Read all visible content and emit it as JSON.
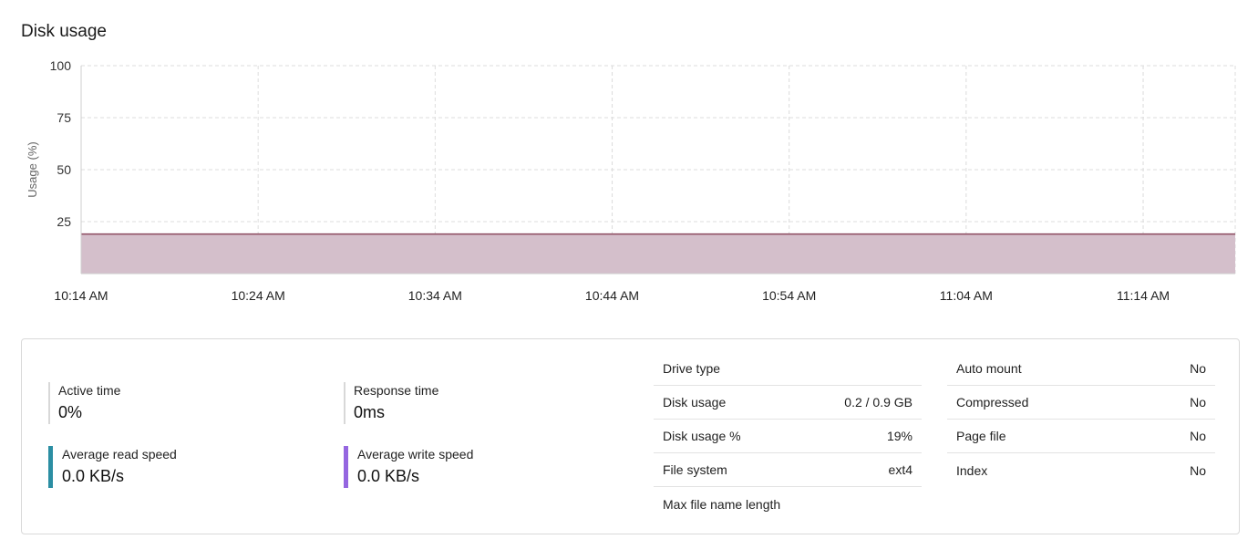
{
  "page": {
    "title": "Disk usage"
  },
  "chart_data": {
    "type": "area",
    "ylabel": "Usage (%)",
    "xlabel": "",
    "ylim": [
      0,
      100
    ],
    "yticks": [
      25,
      50,
      75,
      100
    ],
    "x_ticks": [
      "10:14 AM",
      "10:24 AM",
      "10:34 AM",
      "10:44 AM",
      "10:54 AM",
      "11:04 AM",
      "11:14 AM"
    ],
    "series": [
      {
        "values": [
          19,
          19,
          19,
          19,
          19,
          19,
          19,
          19
        ]
      }
    ],
    "x_minutes": [
      0,
      10,
      20,
      30,
      40,
      50,
      60,
      65.2
    ],
    "grid": true,
    "colors": {
      "line": "#8c4a5f",
      "fill": "#d4bfcb"
    }
  },
  "metrics": {
    "active_time": {
      "label": "Active time",
      "value": "0%"
    },
    "response_time": {
      "label": "Response time",
      "value": "0ms"
    },
    "read_speed": {
      "label": "Average read speed",
      "value": "0.0 KB/s",
      "color": "#2b8ea3"
    },
    "write_speed": {
      "label": "Average write speed",
      "value": "0.0 KB/s",
      "color": "#9566e0"
    }
  },
  "drive_info": [
    {
      "label": "Drive type",
      "value": ""
    },
    {
      "label": "Disk usage",
      "value": "0.2 / 0.9 GB"
    },
    {
      "label": "Disk usage %",
      "value": "19%"
    },
    {
      "label": "File system",
      "value": "ext4"
    },
    {
      "label": "Max file name length",
      "value": ""
    }
  ],
  "flags": [
    {
      "label": "Auto mount",
      "value": "No"
    },
    {
      "label": "Compressed",
      "value": "No"
    },
    {
      "label": "Page file",
      "value": "No"
    },
    {
      "label": "Index",
      "value": "No"
    }
  ]
}
